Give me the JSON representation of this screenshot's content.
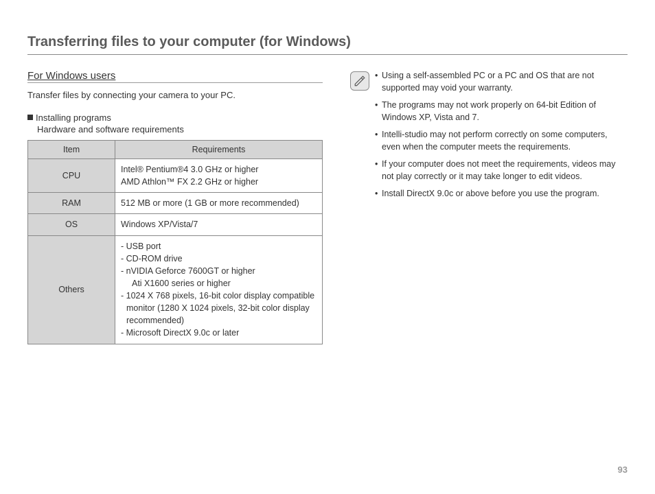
{
  "title": "Transferring files to your computer (for Windows)",
  "section": {
    "heading": "For Windows users",
    "intro": "Transfer files by connecting your camera to your PC.",
    "install_title": "Installing programs",
    "install_sub": "Hardware and software requirements"
  },
  "table": {
    "head_item": "Item",
    "head_req": "Requirements",
    "rows": [
      {
        "item": "CPU",
        "value": "Intel® Pentium®4 3.0 GHz or higher\nAMD Athlon™ FX 2.2 GHz or higher"
      },
      {
        "item": "RAM",
        "value": "512 MB or more (1 GB or more recommended)"
      },
      {
        "item": "OS",
        "value": "Windows XP/Vista/7"
      },
      {
        "item": "Others",
        "value_lines": [
          "- USB port",
          "- CD-ROM drive",
          "- nVIDIA Geforce 7600GT or higher",
          "  Ati X1600 series or higher",
          "- 1024 X 768 pixels, 16-bit color display compatible monitor (1280 X 1024 pixels, 32-bit color display recommended)",
          "- Microsoft DirectX 9.0c or later"
        ]
      }
    ]
  },
  "notes": [
    "Using a self-assembled  PC or a PC and OS that are not supported may void your warranty.",
    "The programs may not work properly on 64-bit Edition of Windows XP, Vista and 7.",
    "Intelli-studio may not perform correctly on some computers, even when the computer meets the requirements.",
    "If your computer does not meet the requirements, videos may not play correctly or it may take longer to edit videos.",
    "Install DirectX 9.0c or above before you use the program."
  ],
  "page_number": "93"
}
